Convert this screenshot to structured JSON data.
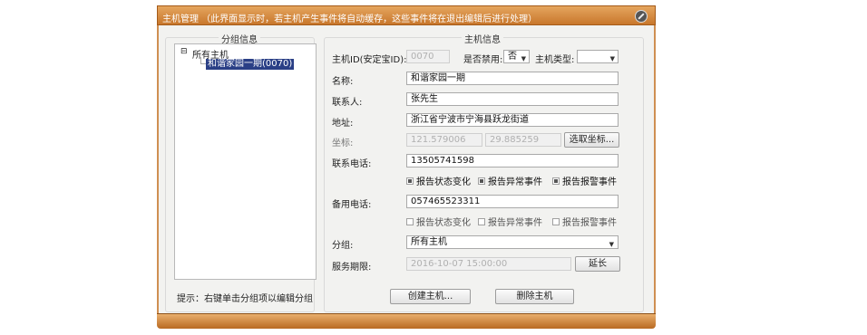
{
  "window": {
    "title": "主机管理 （此界面显示时，若主机产生事件将自动缓存，这些事件将在退出编辑后进行处理）"
  },
  "group_panel": {
    "title": "分组信息",
    "tree": {
      "root": {
        "expander": "⊟",
        "label": "所有主机"
      },
      "child": {
        "label": "和谐家园一期(0070)"
      }
    },
    "hint": "提示：右键单击分组项以编辑分组"
  },
  "host_panel": {
    "title": "主机信息",
    "host_id": {
      "label": "主机ID(安定宝ID):",
      "value": "0070"
    },
    "disabled": {
      "label": "是否禁用:",
      "value": "否"
    },
    "host_type": {
      "label": "主机类型:",
      "value": ""
    },
    "name": {
      "label": "名称:",
      "value": "和谐家园一期"
    },
    "contact": {
      "label": "联系人:",
      "value": "张先生"
    },
    "address": {
      "label": "地址:",
      "value": "浙江省宁波市宁海县跃龙街道"
    },
    "coords": {
      "label": "坐标:",
      "lng": "121.579006",
      "lat": "29.885259",
      "button": "选取坐标..."
    },
    "phone": {
      "label": "联系电话:",
      "value": "13505741598"
    },
    "phone_options": [
      {
        "label": "报告状态变化",
        "checked": true
      },
      {
        "label": "报告异常事件",
        "checked": true
      },
      {
        "label": "报告报警事件",
        "checked": true
      }
    ],
    "backup_phone": {
      "label": "备用电话:",
      "value": "057465523311"
    },
    "backup_options": [
      {
        "label": "报告状态变化",
        "checked": false
      },
      {
        "label": "报告异常事件",
        "checked": false
      },
      {
        "label": "报告报警事件",
        "checked": false
      }
    ],
    "group": {
      "label": "分组:",
      "value": "所有主机"
    },
    "service": {
      "label": "服务期限:",
      "value": "2016-10-07 15:00:00",
      "button": "延长"
    }
  },
  "actions": {
    "create": "创建主机...",
    "delete": "删除主机"
  }
}
